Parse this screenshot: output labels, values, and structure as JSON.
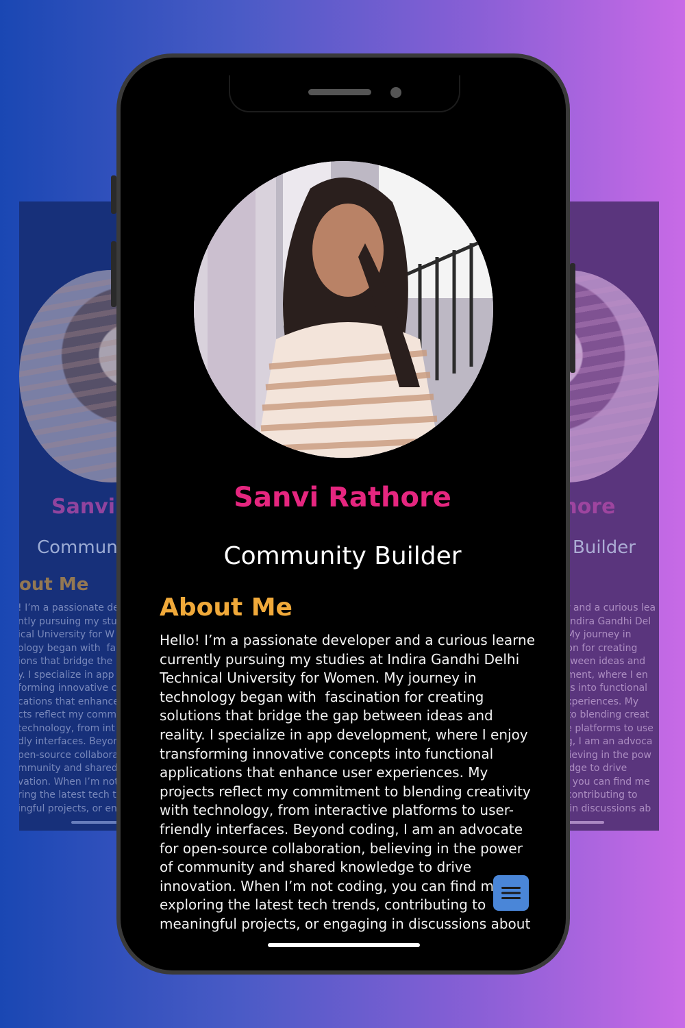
{
  "profile": {
    "name": "Sanvi Rathore",
    "role": "Community Builder",
    "avatar_alt": "profile photo"
  },
  "about": {
    "title": "About Me",
    "lines": [
      "Hello! I’m a passionate developer and a curious learner",
      "currently pursuing my studies at Indira Gandhi Delhi",
      "Technical University for Women. My journey in",
      "technology began with  fascination for creating",
      "solutions that bridge the gap between ideas and",
      "reality. I specialize in app development, where I enjoy",
      "transforming innovative concepts into functional",
      "applications that enhance user experiences. My",
      "projects reflect my commitment to blending creativity",
      "with technology, from interactive platforms to user-",
      "friendly interfaces. Beyond coding, I am an advocate",
      "for open-source collaboration, believing in the power",
      "of community and shared knowledge to drive",
      "innovation. When I’m not coding, you can find me",
      "exploring the latest tech trends, contributing to",
      "meaningful projects, or engaging in discussions about"
    ]
  },
  "background_left": {
    "name_fragment": "Sanvi R",
    "role_fragment": "Commun",
    "about_fragment": "out Me",
    "lines": [
      "! I’m a passionate de",
      "ntly pursuing my stu",
      "ical University for W",
      "ology began with  fa",
      "ions that bridge the",
      "y. I specialize in app",
      "forming innovative c",
      "cations that enhance",
      "cts reflect my comm",
      "technology, from int",
      "dly interfaces. Beyon",
      "pen-source collabora",
      "mmunity and shared",
      "vation. When I’m not",
      "ring the latest tech t",
      "ingful projects, or en"
    ]
  },
  "background_right": {
    "name_fragment": "thore",
    "role_fragment": "Builder",
    "lines": [
      "er and a curious lea",
      "t Indira Gandhi Del",
      ". My journey in",
      "tion for creating",
      "etween ideas and",
      "pment, where I en",
      "pts into functional",
      "experiences. My",
      "t to blending creat",
      "ve platforms to use",
      "ng, I am an advoca",
      "elieving in the pow",
      "ledge to drive",
      "g, you can find me",
      ", contributing to",
      "g in discussions ab"
    ]
  },
  "menu_button": {
    "icon": "hamburger-menu-icon"
  },
  "colors": {
    "name": "#e5267f",
    "about_title": "#f0a93a",
    "menu_button": "#4a86d8",
    "gradient_left": "#1a47b3",
    "gradient_right": "#c86ae6"
  }
}
